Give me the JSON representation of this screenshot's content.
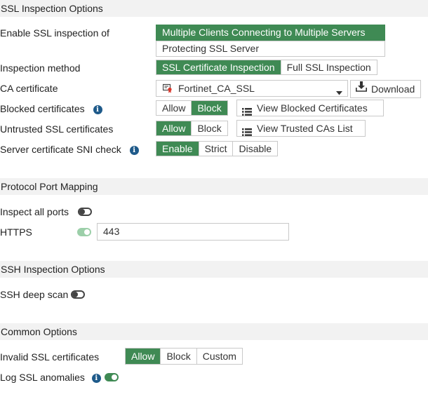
{
  "ssl_section": {
    "title": "SSL Inspection Options",
    "enable_label": "Enable SSL inspection of",
    "enable_options": [
      "Multiple Clients Connecting to Multiple Servers",
      "Protecting SSL Server"
    ],
    "enable_selected": "Multiple Clients Connecting to Multiple Servers",
    "method_label": "Inspection method",
    "method_options": [
      "SSL Certificate Inspection",
      "Full SSL Inspection"
    ],
    "method_selected": "SSL Certificate Inspection",
    "ca_label": "CA certificate",
    "ca_value": "Fortinet_CA_SSL",
    "download_label": "Download",
    "blocked_label": "Blocked certificates",
    "blocked_options": [
      "Allow",
      "Block"
    ],
    "blocked_selected": "Block",
    "view_blocked_label": "View Blocked Certificates",
    "untrusted_label": "Untrusted SSL certificates",
    "untrusted_options": [
      "Allow",
      "Block"
    ],
    "untrusted_selected": "Allow",
    "view_trusted_label": "View Trusted CAs List",
    "sni_label": "Server certificate SNI check",
    "sni_options": [
      "Enable",
      "Strict",
      "Disable"
    ],
    "sni_selected": "Enable"
  },
  "port_section": {
    "title": "Protocol Port Mapping",
    "inspect_all_label": "Inspect all ports",
    "inspect_all_enabled": false,
    "https_label": "HTTPS",
    "https_enabled": true,
    "https_port": "443"
  },
  "ssh_section": {
    "title": "SSH Inspection Options",
    "deep_scan_label": "SSH deep scan",
    "deep_scan_enabled": false
  },
  "common_section": {
    "title": "Common Options",
    "invalid_label": "Invalid SSL certificates",
    "invalid_options": [
      "Allow",
      "Block",
      "Custom"
    ],
    "invalid_selected": "Allow",
    "log_label": "Log SSL anomalies",
    "log_enabled": true
  },
  "icons": {
    "info": "info-icon",
    "certificate": "certificate-icon",
    "dropdown": "caret-down-icon",
    "download": "download-icon",
    "list": "list-icon"
  },
  "colors": {
    "accent": "#3f8a54",
    "section_bg": "#f2f2f2",
    "info": "#1e5a8a"
  }
}
